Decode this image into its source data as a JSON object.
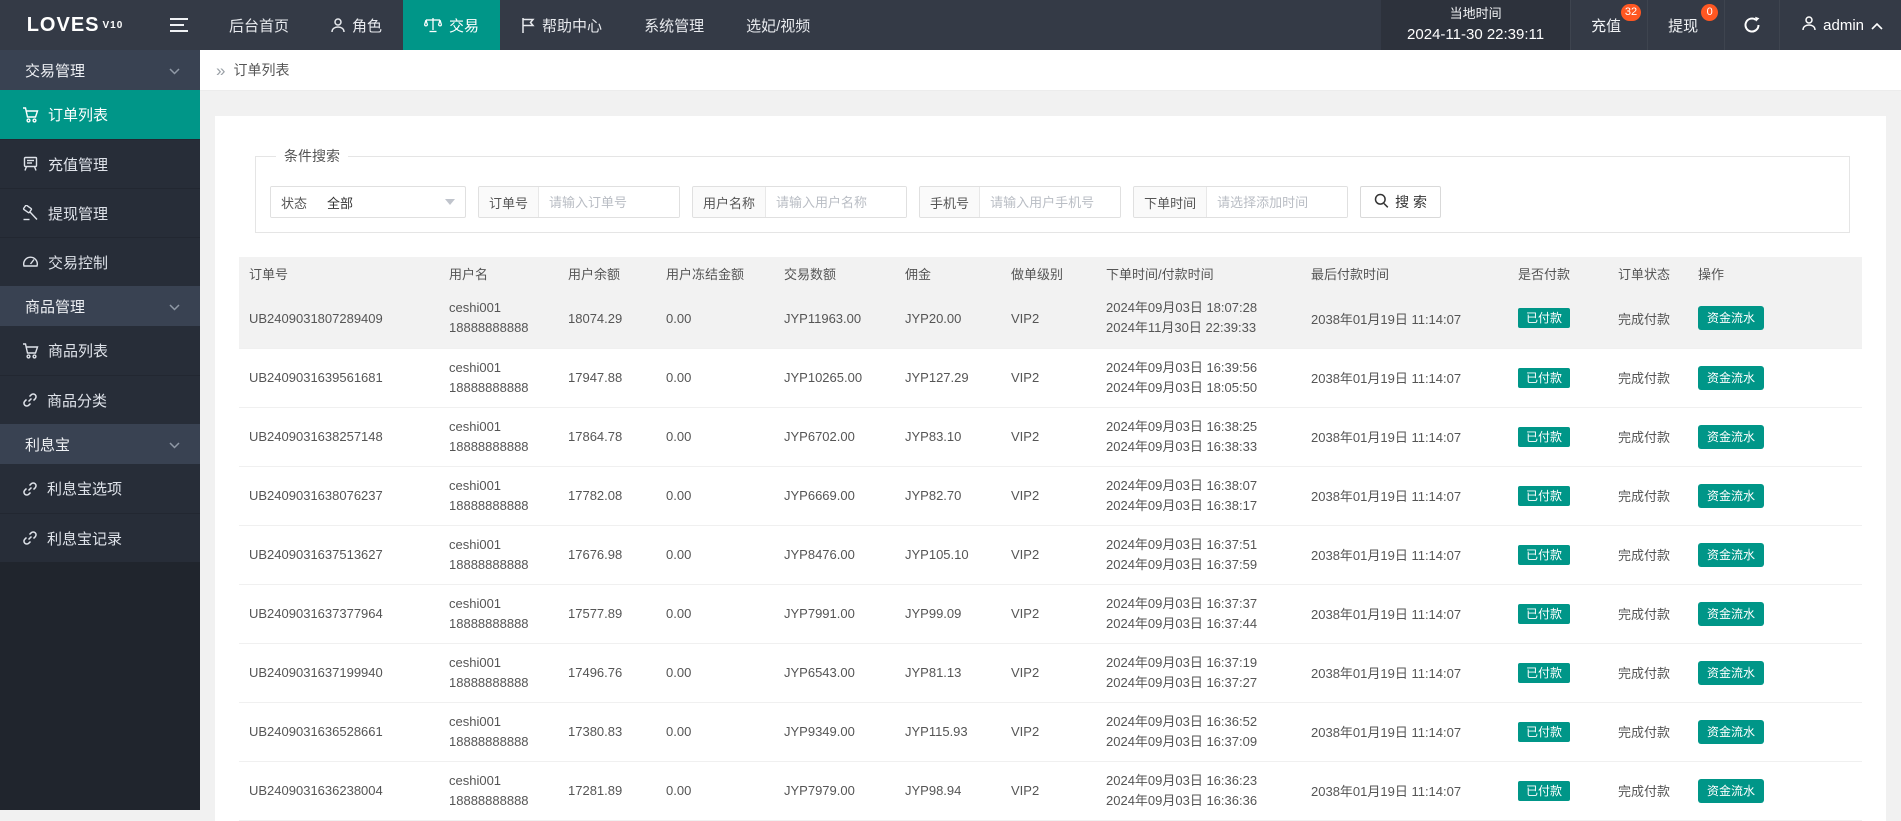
{
  "colors": {
    "accent": "#009688",
    "badge": "#ff5722"
  },
  "navbar": {
    "logo": "LOVES",
    "logo_version": "V10",
    "menu": [
      {
        "label": "后台首页",
        "active": false
      },
      {
        "label": "角色",
        "active": false
      },
      {
        "label": "交易",
        "active": true
      },
      {
        "label": "帮助中心",
        "active": false
      },
      {
        "label": "系统管理",
        "active": false
      },
      {
        "label": "选妃/视频",
        "active": false
      }
    ],
    "time_label": "当地时间",
    "time_value": "2024-11-30 22:39:11",
    "recharge": {
      "label": "充值",
      "badge": "32"
    },
    "withdraw": {
      "label": "提现",
      "badge": "0"
    },
    "username": "admin"
  },
  "sidebar": {
    "items": [
      {
        "type": "group",
        "label": "交易管理"
      },
      {
        "type": "item",
        "label": "订单列表",
        "icon": "cart",
        "active": true
      },
      {
        "type": "item",
        "label": "充值管理",
        "icon": "terminal",
        "active": false
      },
      {
        "type": "item",
        "label": "提现管理",
        "icon": "gavel",
        "active": false
      },
      {
        "type": "item",
        "label": "交易控制",
        "icon": "gauge",
        "active": false
      },
      {
        "type": "group",
        "label": "商品管理"
      },
      {
        "type": "item",
        "label": "商品列表",
        "icon": "cart",
        "active": false
      },
      {
        "type": "item",
        "label": "商品分类",
        "icon": "link",
        "active": false
      },
      {
        "type": "group",
        "label": "利息宝"
      },
      {
        "type": "item",
        "label": "利息宝选项",
        "icon": "link",
        "active": false
      },
      {
        "type": "item",
        "label": "利息宝记录",
        "icon": "link",
        "active": false
      }
    ]
  },
  "breadcrumb": {
    "label": "订单列表"
  },
  "filters": {
    "legend": "条件搜索",
    "status": {
      "label": "状态",
      "value": "全部"
    },
    "order_no": {
      "label": "订单号",
      "placeholder": "请输入订单号"
    },
    "username": {
      "label": "用户名称",
      "placeholder": "请输入用户名称"
    },
    "phone": {
      "label": "手机号",
      "placeholder": "请输入用户手机号"
    },
    "order_time": {
      "label": "下单时间",
      "placeholder": "请选择添加时间"
    },
    "search_label": "搜 索"
  },
  "table": {
    "columns": [
      "订单号",
      "用户名",
      "用户余额",
      "用户冻结金额",
      "交易数额",
      "佣金",
      "做单级别",
      "下单时间/付款时间",
      "最后付款时间",
      "是否付款",
      "订单状态",
      "操作"
    ],
    "rows": [
      {
        "order_no": "UB2409031807289409",
        "username": "ceshi001",
        "phone": "18888888888",
        "balance": "18074.29",
        "frozen": "0.00",
        "amount": "JYP11963.00",
        "commission": "JYP20.00",
        "level": "VIP2",
        "order_time": "2024年09月03日 18:07:28",
        "pay_time": "2024年11月30日 22:39:33",
        "last_pay_time": "2038年01月19日 11:14:07",
        "paid": "已付款",
        "status": "完成付款",
        "action": "资金流水"
      },
      {
        "order_no": "UB2409031639561681",
        "username": "ceshi001",
        "phone": "18888888888",
        "balance": "17947.88",
        "frozen": "0.00",
        "amount": "JYP10265.00",
        "commission": "JYP127.29",
        "level": "VIP2",
        "order_time": "2024年09月03日 16:39:56",
        "pay_time": "2024年09月03日 18:05:50",
        "last_pay_time": "2038年01月19日 11:14:07",
        "paid": "已付款",
        "status": "完成付款",
        "action": "资金流水"
      },
      {
        "order_no": "UB2409031638257148",
        "username": "ceshi001",
        "phone": "18888888888",
        "balance": "17864.78",
        "frozen": "0.00",
        "amount": "JYP6702.00",
        "commission": "JYP83.10",
        "level": "VIP2",
        "order_time": "2024年09月03日 16:38:25",
        "pay_time": "2024年09月03日 16:38:33",
        "last_pay_time": "2038年01月19日 11:14:07",
        "paid": "已付款",
        "status": "完成付款",
        "action": "资金流水"
      },
      {
        "order_no": "UB2409031638076237",
        "username": "ceshi001",
        "phone": "18888888888",
        "balance": "17782.08",
        "frozen": "0.00",
        "amount": "JYP6669.00",
        "commission": "JYP82.70",
        "level": "VIP2",
        "order_time": "2024年09月03日 16:38:07",
        "pay_time": "2024年09月03日 16:38:17",
        "last_pay_time": "2038年01月19日 11:14:07",
        "paid": "已付款",
        "status": "完成付款",
        "action": "资金流水"
      },
      {
        "order_no": "UB2409031637513627",
        "username": "ceshi001",
        "phone": "18888888888",
        "balance": "17676.98",
        "frozen": "0.00",
        "amount": "JYP8476.00",
        "commission": "JYP105.10",
        "level": "VIP2",
        "order_time": "2024年09月03日 16:37:51",
        "pay_time": "2024年09月03日 16:37:59",
        "last_pay_time": "2038年01月19日 11:14:07",
        "paid": "已付款",
        "status": "完成付款",
        "action": "资金流水"
      },
      {
        "order_no": "UB2409031637377964",
        "username": "ceshi001",
        "phone": "18888888888",
        "balance": "17577.89",
        "frozen": "0.00",
        "amount": "JYP7991.00",
        "commission": "JYP99.09",
        "level": "VIP2",
        "order_time": "2024年09月03日 16:37:37",
        "pay_time": "2024年09月03日 16:37:44",
        "last_pay_time": "2038年01月19日 11:14:07",
        "paid": "已付款",
        "status": "完成付款",
        "action": "资金流水"
      },
      {
        "order_no": "UB2409031637199940",
        "username": "ceshi001",
        "phone": "18888888888",
        "balance": "17496.76",
        "frozen": "0.00",
        "amount": "JYP6543.00",
        "commission": "JYP81.13",
        "level": "VIP2",
        "order_time": "2024年09月03日 16:37:19",
        "pay_time": "2024年09月03日 16:37:27",
        "last_pay_time": "2038年01月19日 11:14:07",
        "paid": "已付款",
        "status": "完成付款",
        "action": "资金流水"
      },
      {
        "order_no": "UB2409031636528661",
        "username": "ceshi001",
        "phone": "18888888888",
        "balance": "17380.83",
        "frozen": "0.00",
        "amount": "JYP9349.00",
        "commission": "JYP115.93",
        "level": "VIP2",
        "order_time": "2024年09月03日 16:36:52",
        "pay_time": "2024年09月03日 16:37:09",
        "last_pay_time": "2038年01月19日 11:14:07",
        "paid": "已付款",
        "status": "完成付款",
        "action": "资金流水"
      },
      {
        "order_no": "UB2409031636238004",
        "username": "ceshi001",
        "phone": "18888888888",
        "balance": "17281.89",
        "frozen": "0.00",
        "amount": "JYP7979.00",
        "commission": "JYP98.94",
        "level": "VIP2",
        "order_time": "2024年09月03日 16:36:23",
        "pay_time": "2024年09月03日 16:36:36",
        "last_pay_time": "2038年01月19日 11:14:07",
        "paid": "已付款",
        "status": "完成付款",
        "action": "资金流水"
      }
    ]
  }
}
